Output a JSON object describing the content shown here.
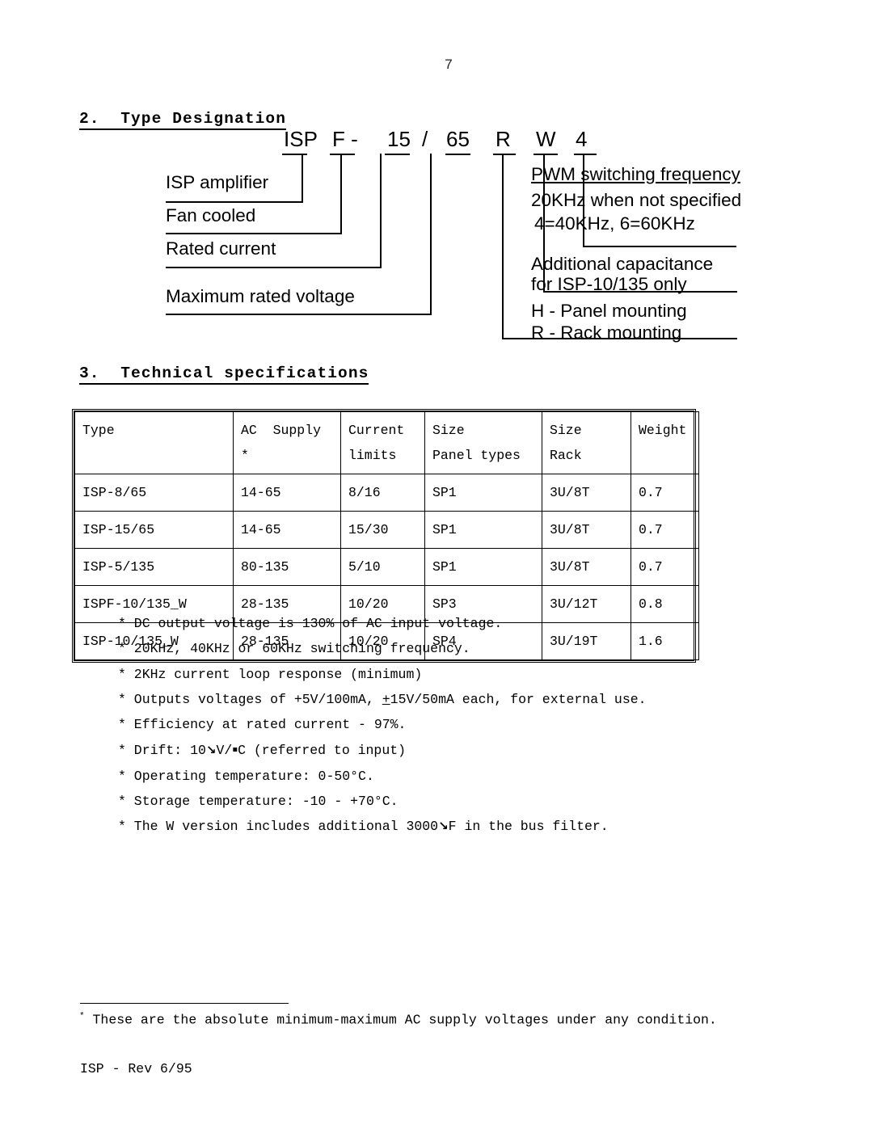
{
  "page": {
    "number": "7",
    "revision": "ISP - Rev 6/95"
  },
  "sections": {
    "type_designation": {
      "heading": "2.  Type Designation",
      "code": {
        "isp": "ISP",
        "f": "F -",
        "current": "15",
        "slash": "/",
        "voltage": "65",
        "mounting": "R",
        "capacitance": "W",
        "frequency": "4"
      },
      "left_labels": [
        "ISP amplifier",
        "Fan cooled",
        "Rated current",
        "Maximum rated voltage"
      ],
      "right_labels": {
        "pwm_title": "PWM switching frequency",
        "pwm_line1": "20KHz when not specified",
        "pwm_line2": "4=40KHz, 6=60KHz",
        "cap_line1": "Additional capacitance",
        "cap_line2": "for ISP-10/135 only",
        "mount_line1": "H - Panel mounting",
        "mount_line2": "R - Rack mounting"
      }
    },
    "technical_specifications": {
      "heading": "3.  Technical specifications",
      "table": {
        "headers": [
          {
            "line1": "Type",
            "line2": ""
          },
          {
            "line1": "AC  Supply",
            "line2": "*"
          },
          {
            "line1": "Current",
            "line2": "limits"
          },
          {
            "line1": "Size",
            "line2": "Panel types"
          },
          {
            "line1": "Size",
            "line2": "Rack"
          },
          {
            "line1": "Weight",
            "line2": ""
          }
        ],
        "rows": [
          [
            "ISP-8/65",
            "14-65",
            "8/16",
            "SP1",
            "3U/8T",
            "0.7"
          ],
          [
            "ISP-15/65",
            "14-65",
            "15/30",
            "SP1",
            "3U/8T",
            "0.7"
          ],
          [
            "ISP-5/135",
            "80-135",
            "5/10",
            "SP1",
            "3U/8T",
            "0.7"
          ],
          [
            "ISPF-10/135_W",
            "28-135",
            "10/20",
            "SP3",
            "3U/12T",
            "0.8"
          ],
          [
            "ISP-10/135_W",
            "28-135",
            "10/20",
            "SP4",
            "3U/19T",
            "1.6"
          ]
        ]
      },
      "notes": [
        "* DC output voltage is 130% of AC input voltage.",
        "* 20KHz, 40KHz or 60KHz switching frequency.",
        "* 2KHz current loop response (minimum)",
        "* Efficiency at rated current - 97%.",
        "* Operating temperature: 0-50°C.",
        "* Storage temperature: -10 - +70°C."
      ],
      "note_outputs_prefix": "* Outputs voltages of +5V/100mA, ",
      "note_outputs_underlined": "+",
      "note_outputs_suffix": "15V/50mA each, for external use.",
      "note_drift_prefix": "* Drift: 10",
      "note_drift_mid": "V/",
      "note_drift_suffix": "C (referred to input)",
      "note_w_prefix": "* The W version includes additional 3000",
      "note_w_suffix": "F in the bus filter.",
      "glyph_mu": "↘",
      "glyph_deg": "▪"
    }
  },
  "footnote": {
    "marker": "*",
    "text": " These are the absolute minimum-maximum AC supply voltages under any condition."
  }
}
